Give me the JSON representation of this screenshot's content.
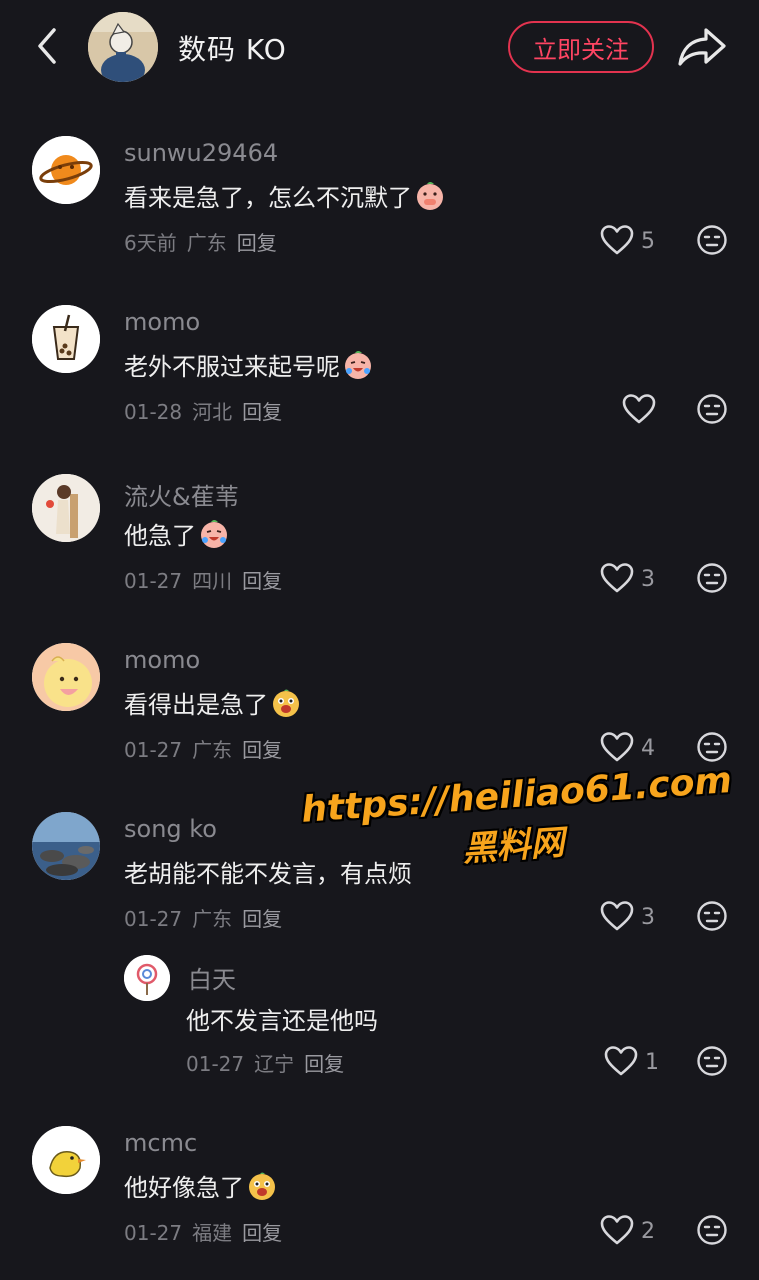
{
  "header": {
    "title": "数码 KO",
    "follow_label": "立即关注"
  },
  "comments": [
    {
      "username": "sunwu29464",
      "text": "看来是急了，怎么不沉默了",
      "date": "6天前",
      "location": "广东",
      "reply_label": "回复",
      "likes": "5",
      "emoji": "peach-shush"
    },
    {
      "username": "momo",
      "text": "老外不服过来起号呢",
      "date": "01-28",
      "location": "河北",
      "reply_label": "回复",
      "likes": "",
      "emoji": "peach-laugh-cry"
    },
    {
      "username": "流火&萑苇",
      "text": "他急了",
      "date": "01-27",
      "location": "四川",
      "reply_label": "回复",
      "likes": "3",
      "emoji": "peach-laugh-cry"
    },
    {
      "username": "momo",
      "text": "看得出是急了",
      "date": "01-27",
      "location": "广东",
      "reply_label": "回复",
      "likes": "4",
      "emoji": "dog-face"
    },
    {
      "username": "song ko",
      "text": "老胡能不能不发言，有点烦",
      "date": "01-27",
      "location": "广东",
      "reply_label": "回复",
      "likes": "3",
      "emoji": ""
    },
    {
      "username": "白天",
      "text": "他不发言还是他吗",
      "date": "01-27",
      "location": "辽宁",
      "reply_label": "回复",
      "likes": "1",
      "emoji": ""
    },
    {
      "username": "mcmc",
      "text": "他好像急了",
      "date": "01-27",
      "location": "福建",
      "reply_label": "回复",
      "likes": "2",
      "emoji": "dog-face"
    }
  ],
  "watermark": {
    "url": "https://heiliao61.com",
    "name": "黑料网"
  },
  "colors": {
    "background": "#17171c",
    "accent": "#ff4563",
    "watermark": "#f7a41c"
  }
}
